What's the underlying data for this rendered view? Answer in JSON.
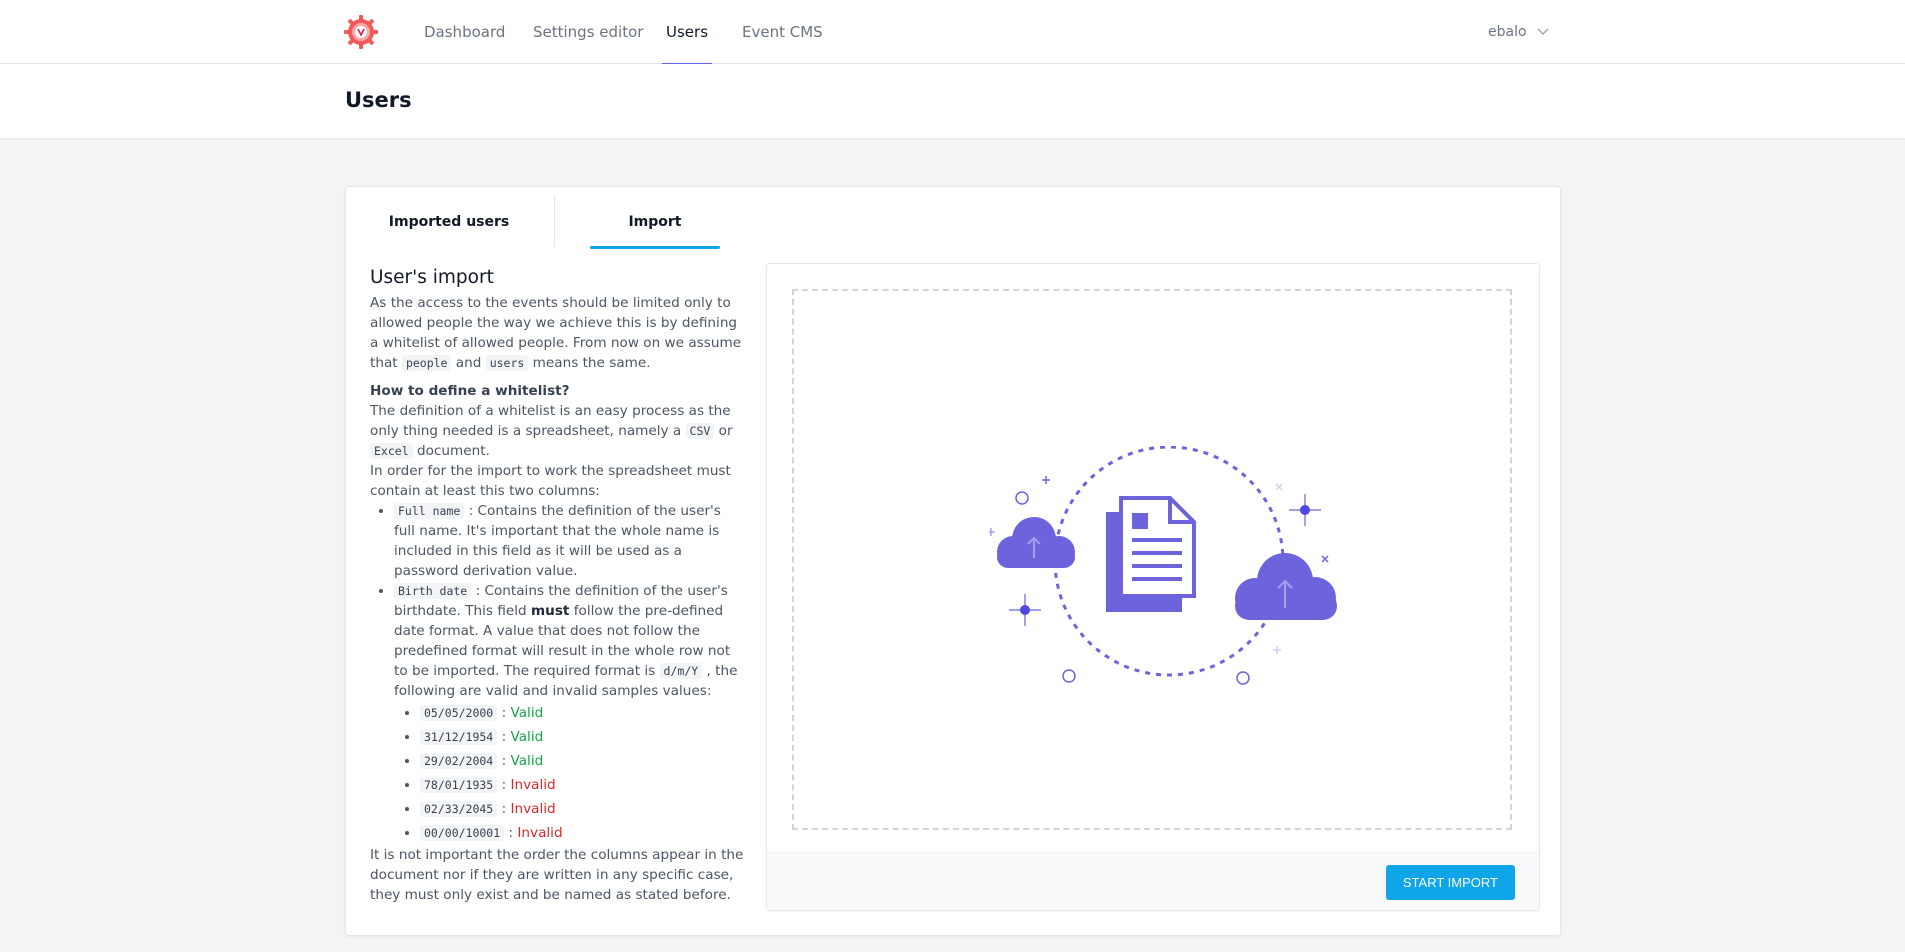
{
  "nav": {
    "items": [
      {
        "label": "Dashboard"
      },
      {
        "label": "Settings editor"
      },
      {
        "label": "Users"
      },
      {
        "label": "Event CMS"
      }
    ],
    "user": "ebalo"
  },
  "page": {
    "title": "Users"
  },
  "tabs": [
    {
      "label": "Imported users"
    },
    {
      "label": "Import"
    }
  ],
  "import_doc": {
    "heading": "User's import",
    "intro_1": "As the access to the events should be limited only to allowed people the way we achieve this is by defining a whitelist of allowed people. From now on we assume that ",
    "code_people": "people",
    "intro_and": " and ",
    "code_users": "users",
    "intro_2": " means the same.",
    "howto_title": "How to define a whitelist?",
    "def_1": "The definition of a whitelist is an easy process as the only thing needed is a spreadsheet, namely a ",
    "code_csv": "CSV",
    "def_or": " or ",
    "code_excel": "Excel",
    "def_2": " document.",
    "order_text": "In order for the import to work the spreadsheet must contain at least this two columns:",
    "col1_code": "Full name",
    "col1_text": " : Contains the definition of the user's full name. It's important that the whole name is included in this field as it will be used as a password derivation value.",
    "col2_code": "Birth date",
    "col2_text_1": " : Contains the definition of the user's birthdate. This field ",
    "col2_must": "must",
    "col2_text_2": " follow the pre-defined date format. A value that does not follow the predefined format will result in the whole row not to be imported. The required format is ",
    "col2_format": "d/m/Y",
    "col2_text_3": " , the following are valid and invalid samples values:",
    "samples": [
      {
        "value": "05/05/2000",
        "sep": " : ",
        "status": "Valid"
      },
      {
        "value": "31/12/1954",
        "sep": " : ",
        "status": "Valid"
      },
      {
        "value": "29/02/2004",
        "sep": " : ",
        "status": "Valid"
      },
      {
        "value": "78/01/1935",
        "sep": " : ",
        "status": "Invalid"
      },
      {
        "value": "02/33/2045",
        "sep": " : ",
        "status": "Invalid"
      },
      {
        "value": "00/00/10001",
        "sep": " : ",
        "status": "Invalid"
      }
    ],
    "outro": "It is not important the order the columns appear in the document nor if they are written in any specific case, they must only exist and be named as stated before."
  },
  "upload": {
    "illustration": "cloud-upload-document-icon",
    "button_label": "START IMPORT"
  },
  "colors": {
    "accent": "#0ea5e9",
    "nav_active": "#6366f1",
    "illustration": "#6c63dd",
    "valid": "#16a34a",
    "invalid": "#dc2626"
  }
}
